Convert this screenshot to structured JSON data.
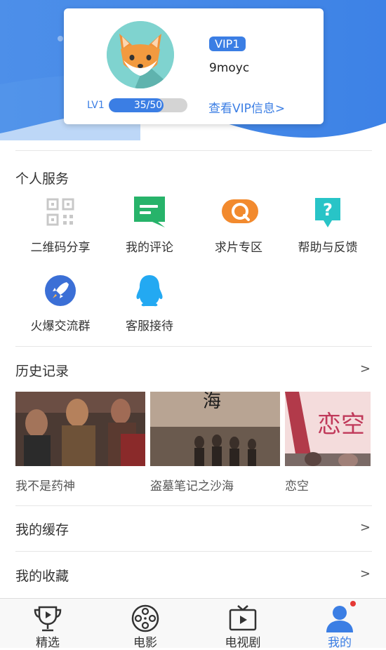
{
  "profile": {
    "vip_badge": "VIP1",
    "username": "9moyc",
    "level_label": "LV1",
    "level_progress_text": "35/50",
    "level_progress": 0.7,
    "vip_link": "查看VIP信息>"
  },
  "services": {
    "title": "个人服务",
    "items": [
      {
        "label": "二维码分享",
        "icon": "qrcode-icon"
      },
      {
        "label": "我的评论",
        "icon": "comment-icon"
      },
      {
        "label": "求片专区",
        "icon": "search-request-icon"
      },
      {
        "label": "帮助与反馈",
        "icon": "help-icon"
      },
      {
        "label": "火爆交流群",
        "icon": "rocket-icon"
      },
      {
        "label": "客服接待",
        "icon": "qq-penguin-icon"
      }
    ]
  },
  "history": {
    "title": "历史记录",
    "arrow": ">",
    "items": [
      {
        "title": "我不是药神"
      },
      {
        "title": "盗墓笔记之沙海"
      },
      {
        "title": "恋空"
      }
    ],
    "poster_texts": [
      "海",
      "恋空"
    ]
  },
  "cache": {
    "title": "我的缓存",
    "arrow": ">"
  },
  "favorites": {
    "title": "我的收藏",
    "arrow": ">"
  },
  "nav": {
    "items": [
      {
        "label": "精选",
        "icon": "trophy-icon"
      },
      {
        "label": "电影",
        "icon": "film-reel-icon"
      },
      {
        "label": "电视剧",
        "icon": "tv-icon"
      },
      {
        "label": "我的",
        "icon": "user-icon"
      }
    ],
    "active": "我的"
  },
  "colors": {
    "accent": "#3b7ee4",
    "hero_bg": "#4a8ee8",
    "badge_dot": "#e53935"
  }
}
